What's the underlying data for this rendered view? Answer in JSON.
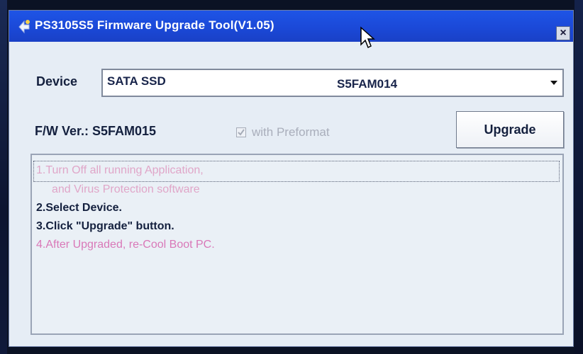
{
  "window": {
    "title": "PS3105S5 Firmware Upgrade Tool(V1.05)",
    "close_label": "×"
  },
  "device": {
    "label": "Device",
    "name": "SATA SSD",
    "firmware": "S5FAM014"
  },
  "firmware": {
    "label": "F/W Ver.: S5FAM015"
  },
  "preformat": {
    "label": "with Preformat",
    "checked": true,
    "enabled": false
  },
  "upgrade_button": {
    "label": "Upgrade"
  },
  "instructions": [
    "1.Turn Off all running Application,",
    "and Virus Protection software",
    "2.Select Device.",
    "3.Click \"Upgrade\" button.",
    "4.After Upgraded, re-Cool Boot PC."
  ],
  "colors": {
    "titlebar": "#1b49d8",
    "dim_text": "#e0a6c8",
    "pink_text": "#d978b8",
    "dark_text": "#14203e"
  }
}
